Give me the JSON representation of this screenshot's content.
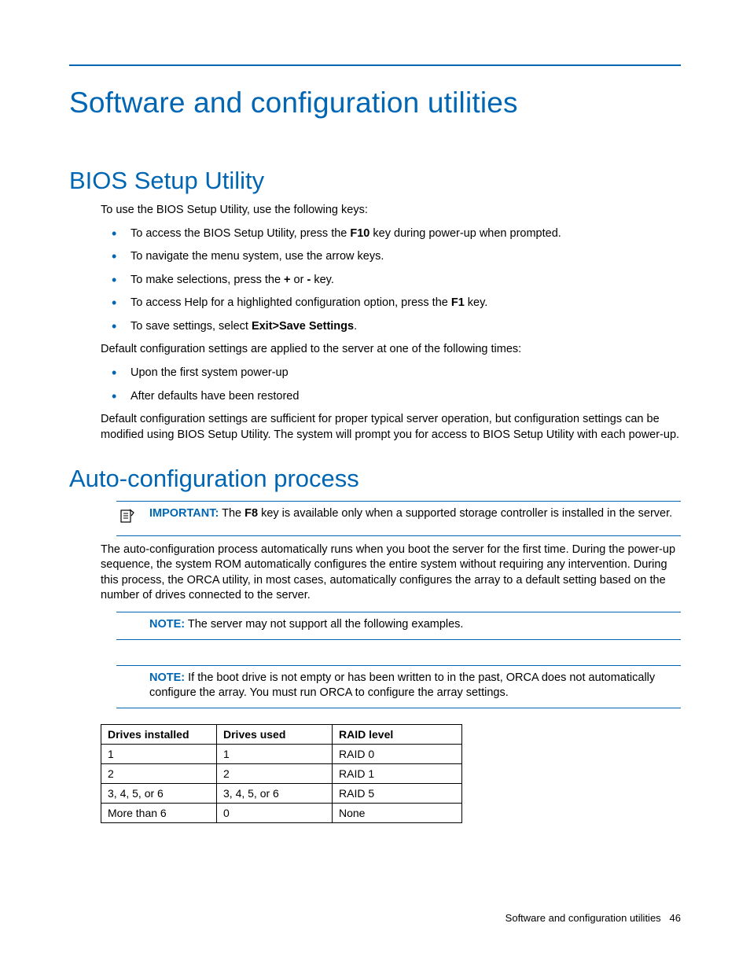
{
  "chapter_title": "Software and configuration utilities",
  "section_bios": {
    "title": "BIOS Setup Utility",
    "intro": "To use the BIOS Setup Utility, use the following keys:",
    "bullets1": [
      {
        "pre": "To access the BIOS Setup Utility, press the ",
        "bold": "F10",
        "post": " key during power-up when prompted."
      },
      {
        "pre": "To navigate the menu system, use the arrow keys.",
        "bold": "",
        "post": ""
      },
      {
        "pre": "To make selections, press the ",
        "bold": "+",
        "mid": " or ",
        "bold2": "-",
        "post": " key."
      },
      {
        "pre": "To access Help for a highlighted configuration option, press the ",
        "bold": "F1",
        "post": " key."
      },
      {
        "pre": "To save settings, select ",
        "bold": "Exit>Save Settings",
        "post": "."
      }
    ],
    "para2": "Default configuration settings are applied to the server at one of the following times:",
    "bullets2": [
      "Upon the first system power-up",
      "After defaults have been restored"
    ],
    "para3": "Default configuration settings are sufficient for proper typical server operation, but configuration settings can be modified using BIOS Setup Utility. The system will prompt you for access to BIOS Setup Utility with each power-up."
  },
  "section_auto": {
    "title": "Auto-configuration process",
    "important": {
      "label": "IMPORTANT:",
      "pre": "  The ",
      "bold": "F8",
      "post": " key is available only when a supported storage controller is installed in the server."
    },
    "para1": "The auto-configuration process automatically runs when you boot the server for the first time. During the power-up sequence, the system ROM automatically configures the entire system without requiring any intervention. During this process, the ORCA utility, in most cases, automatically configures the array to a default setting based on the number of drives connected to the server.",
    "note1": {
      "label": "NOTE:",
      "text": "  The server may not support all the following examples."
    },
    "note2": {
      "label": "NOTE:",
      "text": "  If the boot drive is not empty or has been written to in the past, ORCA does not automatically configure the array. You must run ORCA to configure the array settings."
    },
    "table": {
      "headers": [
        "Drives installed",
        "Drives used",
        "RAID level"
      ],
      "rows": [
        [
          "1",
          "1",
          "RAID 0"
        ],
        [
          "2",
          "2",
          "RAID 1"
        ],
        [
          "3, 4, 5, or 6",
          "3, 4, 5, or 6",
          "RAID 5"
        ],
        [
          "More than 6",
          "0",
          "None"
        ]
      ]
    }
  },
  "footer": {
    "text": "Software and configuration utilities",
    "page": "46"
  }
}
